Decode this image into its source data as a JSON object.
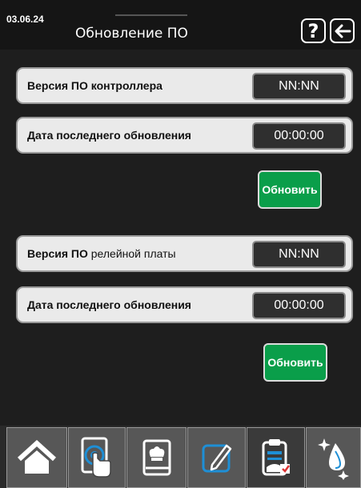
{
  "header": {
    "date": "03.06.24",
    "title": "Обновление ПО",
    "help_icon": "help-icon",
    "back_icon": "back-arrow-icon"
  },
  "controller": {
    "version_label_bold": "Версия ПО контроллера",
    "version_value": "NN:NN",
    "date_label": "Дата последнего обновления",
    "date_value": "00:00:00",
    "update_label": "Обновить"
  },
  "relay": {
    "version_label_bold": "Версия ПО",
    "version_label_rest": "релейной платы",
    "version_value": "NN:NN",
    "date_label": "Дата последнего обновления",
    "date_value": "00:00:00",
    "update_label": "Обновить"
  },
  "bottom_nav": [
    {
      "icon": "home-icon"
    },
    {
      "icon": "touch-tablet-icon"
    },
    {
      "icon": "recipe-book-icon"
    },
    {
      "icon": "edit-pencil-icon"
    },
    {
      "icon": "clipboard-report-icon"
    },
    {
      "icon": "cleaning-drops-icon"
    }
  ],
  "colors": {
    "update_button": "#0a9e4a",
    "panel": "#eaeaea",
    "value_box": "#2f2f2f",
    "nav_item": "#575757",
    "accent_blue": "#1e8fd6"
  }
}
